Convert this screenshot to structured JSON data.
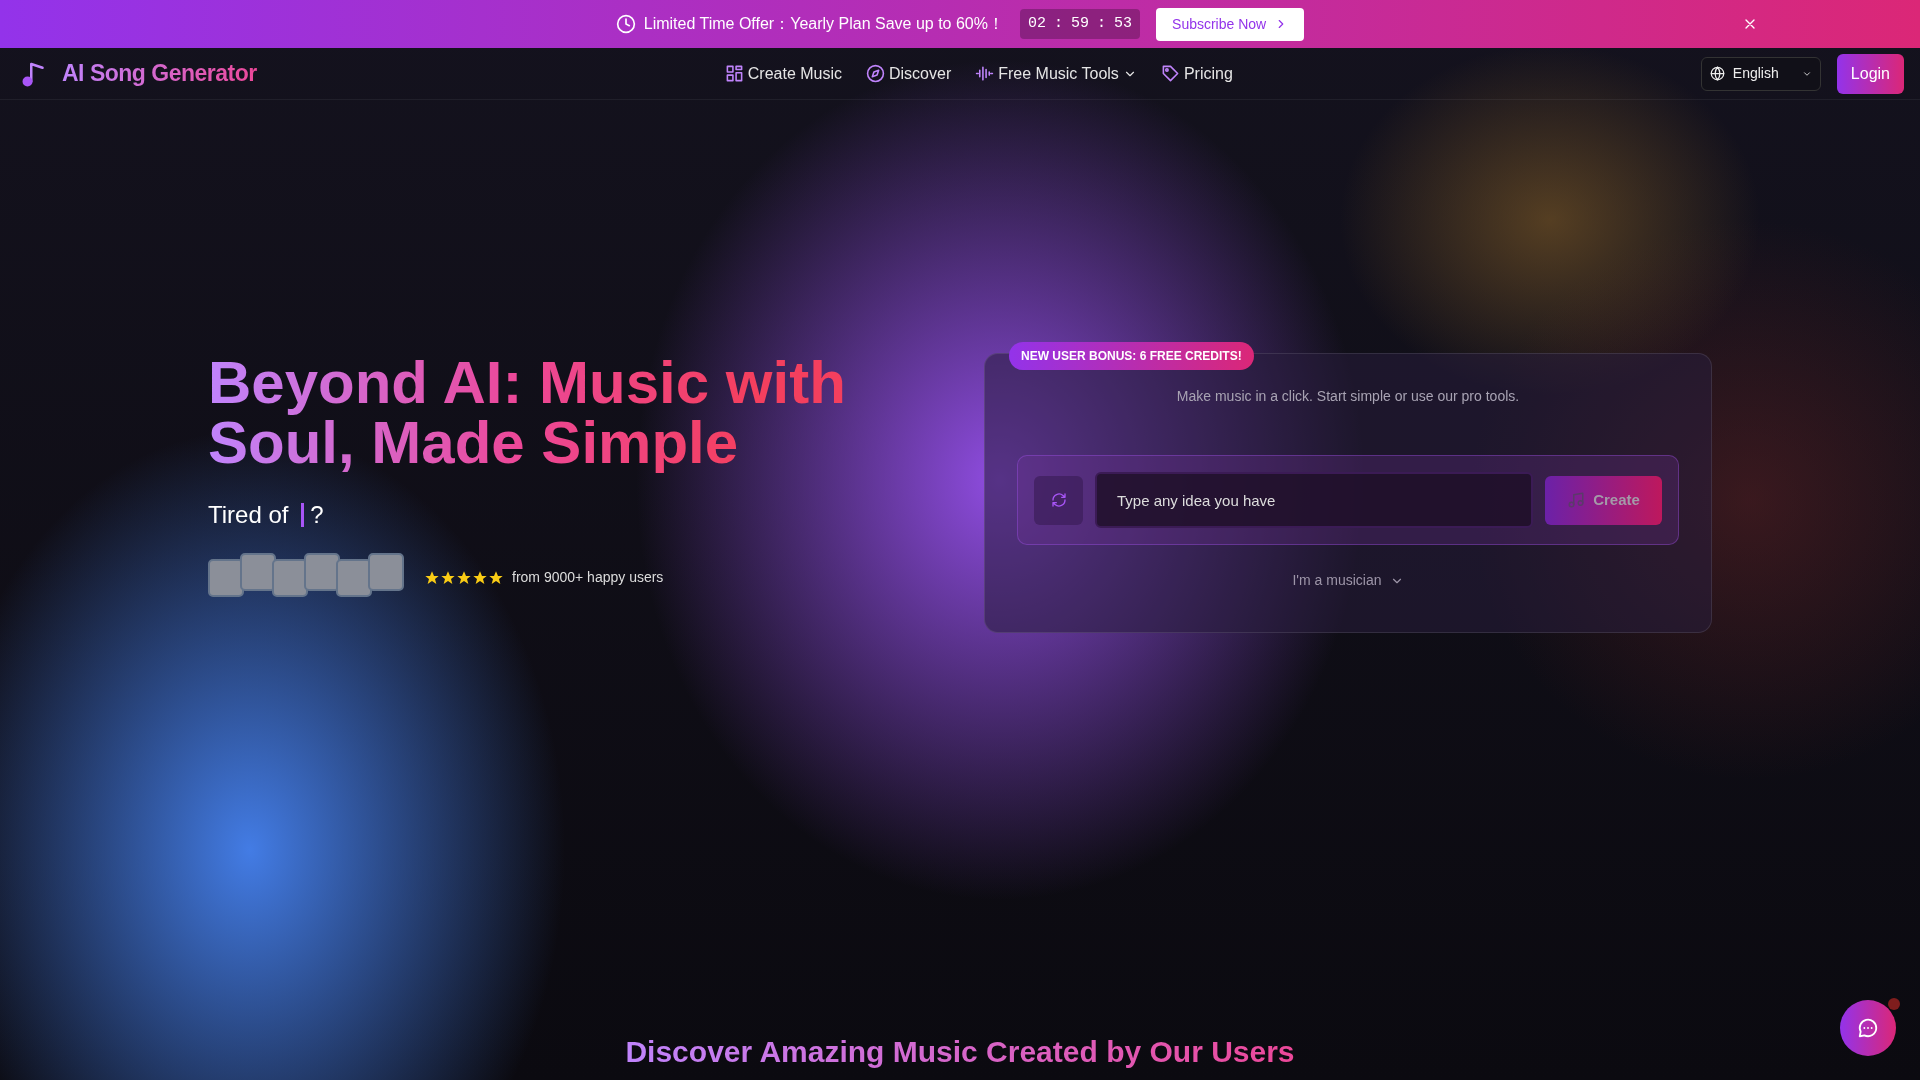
{
  "promo_banner": {
    "text": "Limited Time Offer：Yearly Plan Save up to 60%！",
    "countdown": [
      "02",
      ":",
      "59",
      ":",
      "53"
    ],
    "button": "Subscribe Now"
  },
  "navbar": {
    "brand": "AI Song Generator",
    "links": [
      {
        "label": "Create Music",
        "kind": "grid"
      },
      {
        "label": "Discover",
        "kind": "compass"
      },
      {
        "label": "Free Music Tools",
        "kind": "wave",
        "dropdown": true
      },
      {
        "label": "Pricing",
        "kind": "tag"
      }
    ],
    "language": "English",
    "login": "Login"
  },
  "hero": {
    "title": "Beyond AI: Music with Soul, Made Simple",
    "subtitle_prefix": "Tired of",
    "subtitle_suffix": "?",
    "avatars": [
      {
        "kind": "photo"
      },
      {
        "kind": "photo"
      },
      {
        "kind": "photo"
      },
      {
        "kind": "photo"
      },
      {
        "kind": "photo"
      },
      {
        "kind": "photo"
      }
    ],
    "stars": 5,
    "social_proof": "from 9000+ happy users"
  },
  "create_card": {
    "badge": "NEW USER BONUS: 6 FREE CREDITS!",
    "description": "Make music in a click. Start simple or use our pro tools.",
    "placeholder": "Type any idea you have",
    "create_button": "Create",
    "mode_toggle": "I'm a musician"
  },
  "section_heading": "Discover Amazing Music Created by Our Users",
  "chat": {
    "unread": true
  }
}
